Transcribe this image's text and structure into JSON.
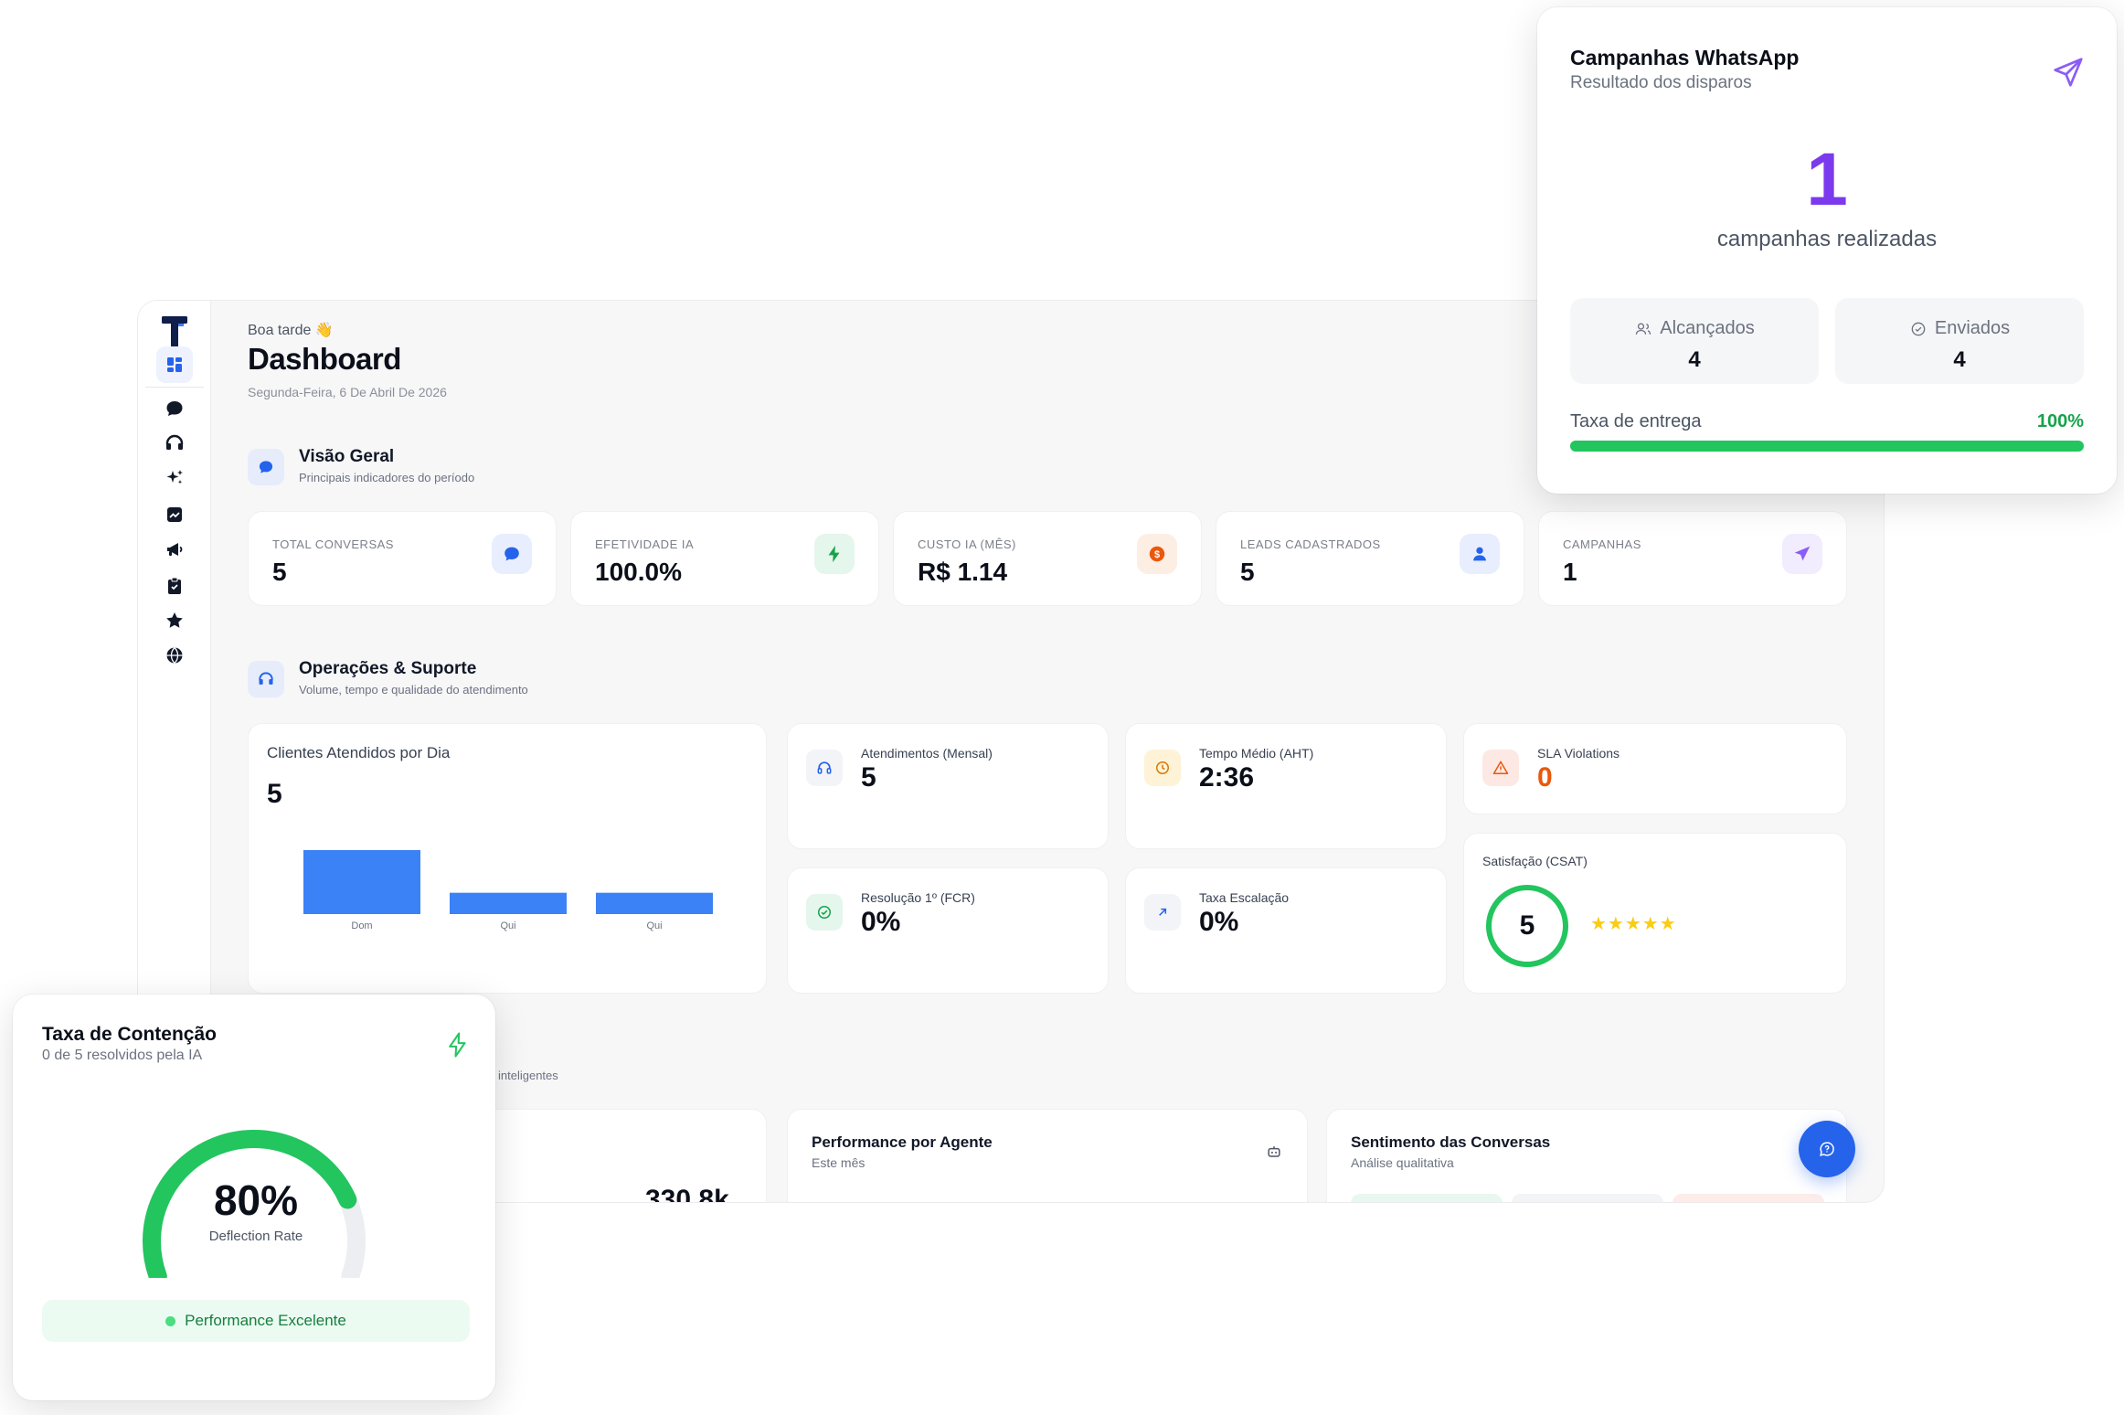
{
  "header": {
    "greeting": "Boa tarde 👋",
    "title": "Dashboard",
    "date": "Segunda-Feira, 6 De Abril De 2026"
  },
  "sidebar": {
    "logo": "T",
    "items": [
      {
        "icon": "grid-icon"
      },
      {
        "icon": "chat-bubble-icon"
      },
      {
        "icon": "headset-icon"
      },
      {
        "icon": "sparkles-icon"
      },
      {
        "icon": "chart-icon"
      },
      {
        "icon": "megaphone-icon"
      },
      {
        "icon": "clipboard-icon"
      },
      {
        "icon": "star-icon"
      },
      {
        "icon": "globe-icon"
      }
    ]
  },
  "overview": {
    "title": "Visão Geral",
    "subtitle": "Principais indicadores do período",
    "kpis": [
      {
        "label": "TOTAL CONVERSAS",
        "value": "5",
        "icon": "chat-bubble-icon",
        "color": "#2563eb"
      },
      {
        "label": "EFETIVIDADE IA",
        "value": "100.0%",
        "icon": "bolt-icon",
        "color": "#16a34a"
      },
      {
        "label": "CUSTO IA (MÊS)",
        "value": "R$ 1.14",
        "icon": "coin-icon",
        "color": "#ea580c"
      },
      {
        "label": "LEADS CADASTRADOS",
        "value": "5",
        "icon": "user-icon",
        "color": "#2563eb"
      },
      {
        "label": "CAMPANHAS",
        "value": "1",
        "icon": "send-icon",
        "color": "#8b5cf6"
      }
    ]
  },
  "operations": {
    "title": "Operações & Suporte",
    "subtitle": "Volume, tempo e qualidade do atendimento",
    "clients_card": {
      "title": "Clientes Atendidos por Dia",
      "value": "5"
    },
    "metrics": {
      "monthly": {
        "label": "Atendimentos (Mensal)",
        "value": "5"
      },
      "aht": {
        "label": "Tempo Médio (AHT)",
        "value": "2:36"
      },
      "sla": {
        "label": "SLA Violations",
        "value": "0"
      },
      "fcr": {
        "label": "Resolução 1º (FCR)",
        "value": "0%"
      },
      "escalation": {
        "label": "Taxa Escalação",
        "value": "0%"
      },
      "csat": {
        "label": "Satisfação (CSAT)",
        "value": "5",
        "stars": "★★★★★"
      }
    }
  },
  "ai_section": {
    "subtitle_fragment": "inteligentes",
    "truncated_value": "330.8k"
  },
  "agent_perf": {
    "title": "Performance por Agente",
    "subtitle": "Este mês"
  },
  "sentiment": {
    "title": "Sentimento das Conversas",
    "subtitle": "Análise qualitativa"
  },
  "whatsapp_popover": {
    "title": "Campanhas WhatsApp",
    "subtitle": "Resultado dos disparos",
    "count": "1",
    "count_label": "campanhas realizadas",
    "reached_label": "Alcançados",
    "reached_value": "4",
    "sent_label": "Enviados",
    "sent_value": "4",
    "delivery_label": "Taxa de entrega",
    "delivery_value": "100%",
    "delivery_fraction": 1.0
  },
  "containment_popover": {
    "title": "Taxa de Contenção",
    "subtitle": "0 de 5 resolvidos pela IA",
    "value": "80%",
    "value_fraction": 0.8,
    "caption": "Deflection Rate",
    "badge": "Performance Excelente"
  },
  "chart_data": {
    "type": "bar",
    "title": "Clientes Atendidos por Dia",
    "categories": [
      "Dom",
      "Qui",
      "Qui"
    ],
    "values": [
      3,
      1,
      1
    ],
    "ylim": [
      0,
      3
    ],
    "grid": false,
    "colors": {
      "bar": "#3b82f6"
    }
  },
  "colors": {
    "accent": "#2563eb",
    "purple": "#7c3aed",
    "green": "#22c55e",
    "orange": "#ea580c"
  }
}
